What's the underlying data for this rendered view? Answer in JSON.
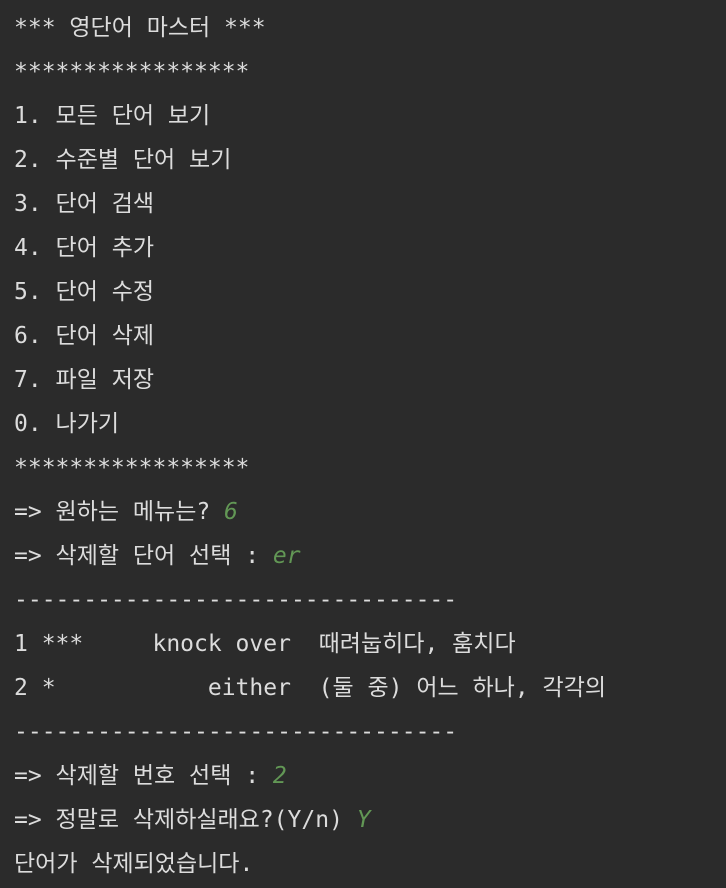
{
  "theme": {
    "background": "#2b2b2b",
    "text": "#dcdcdc",
    "user_input": "#629755"
  },
  "console": {
    "title": "*** 영단어 마스터 ***",
    "stars_top": "*****************",
    "menu": [
      "1. 모든 단어 보기",
      "2. 수준별 단어 보기",
      "3. 단어 검색",
      "4. 단어 추가",
      "5. 단어 수정",
      "6. 단어 삭제",
      "7. 파일 저장",
      "0. 나가기"
    ],
    "stars_bottom": "*****************",
    "menu_prompt": "=> 원하는 메뉴는? ",
    "menu_input": "6",
    "word_prompt": "=> 삭제할 단어 선택 : ",
    "word_input": "er",
    "separator_top": "--------------------------------",
    "results": [
      "1 ***     knock over  때려눕히다, 훔치다",
      "2 *           either  (둘 중) 어느 하나, 각각의"
    ],
    "separator_bottom": "--------------------------------",
    "number_prompt": "=> 삭제할 번호 선택 : ",
    "number_input": "2",
    "confirm_prompt": "=> 정말로 삭제하실래요?(Y/n) ",
    "confirm_input": "Y",
    "result_message": "단어가 삭제되었습니다."
  }
}
